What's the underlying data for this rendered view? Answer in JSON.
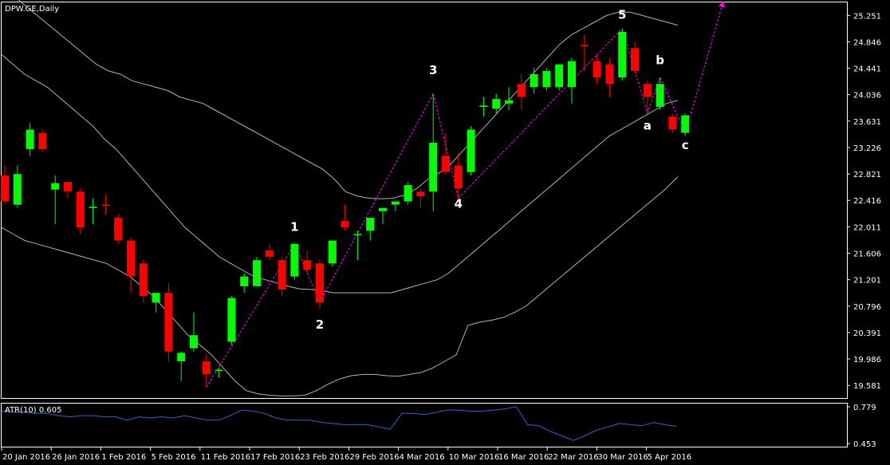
{
  "window": {
    "title": "DPW.GE,Daily",
    "indicator_label": "ATR(10) 0.605"
  },
  "colors": {
    "background": "#000000",
    "bull_candle": "#00ff00",
    "bear_candle": "#ff0000",
    "wick": "#c0c0c0",
    "band": "#b4b4b4",
    "wave_line": "#ff00ff",
    "atr_line": "#3a5fcd",
    "axis": "#ffffff",
    "label": "#ffffff"
  },
  "chart_data": [
    {
      "type": "candlestick",
      "symbol": "DPW.GE",
      "timeframe": "Daily",
      "grid": false,
      "ylim": [
        19.4,
        25.45
      ],
      "y_ticks": [
        "25.251",
        "24.846",
        "24.441",
        "24.036",
        "23.631",
        "23.226",
        "22.821",
        "22.416",
        "22.011",
        "21.606",
        "21.201",
        "20.796",
        "20.391",
        "19.986",
        "19.581"
      ],
      "x_ticks": [
        "20 Jan 2016",
        "26 Jan 2016",
        "1 Feb 2016",
        "5 Feb 2016",
        "11 Feb 2016",
        "17 Feb 2016",
        "23 Feb 2016",
        "29 Feb 2016",
        "4 Mar 2016",
        "10 Mar 2016",
        "16 Mar 2016",
        "22 Mar 2016",
        "30 Mar 2016",
        "5 Apr 2016"
      ],
      "candles": [
        {
          "date": "2016-01-18",
          "open": 22.8,
          "high": 22.95,
          "low": 22.35,
          "close": 22.4
        },
        {
          "date": "2016-01-19",
          "open": 22.35,
          "high": 22.95,
          "low": 22.3,
          "close": 22.82
        },
        {
          "date": "2016-01-20",
          "open": 23.2,
          "high": 23.6,
          "low": 23.1,
          "close": 23.5
        },
        {
          "date": "2016-01-21",
          "open": 23.45,
          "high": 23.5,
          "low": 23.15,
          "close": 23.2
        },
        {
          "date": "2016-01-22",
          "open": 22.58,
          "high": 22.8,
          "low": 22.05,
          "close": 22.68
        },
        {
          "date": "2016-01-25",
          "open": 22.7,
          "high": 22.7,
          "low": 22.45,
          "close": 22.55
        },
        {
          "date": "2016-01-26",
          "open": 22.55,
          "high": 22.6,
          "low": 21.9,
          "close": 22.0
        },
        {
          "date": "2016-01-27",
          "open": 22.3,
          "high": 22.45,
          "low": 22.05,
          "close": 22.32
        },
        {
          "date": "2016-01-28",
          "open": 22.35,
          "high": 22.5,
          "low": 22.2,
          "close": 22.33
        },
        {
          "date": "2016-01-29",
          "open": 22.15,
          "high": 22.2,
          "low": 21.75,
          "close": 21.8
        },
        {
          "date": "2016-02-01",
          "open": 21.8,
          "high": 21.85,
          "low": 21.0,
          "close": 21.25
        },
        {
          "date": "2016-02-02",
          "open": 21.45,
          "high": 21.5,
          "low": 20.85,
          "close": 20.95
        },
        {
          "date": "2016-02-03",
          "open": 20.85,
          "high": 21.0,
          "low": 20.7,
          "close": 21.0
        },
        {
          "date": "2016-02-04",
          "open": 21.0,
          "high": 21.15,
          "low": 19.95,
          "close": 20.1
        },
        {
          "date": "2016-02-05",
          "open": 19.95,
          "high": 20.1,
          "low": 19.65,
          "close": 20.08
        },
        {
          "date": "2016-02-08",
          "open": 20.15,
          "high": 20.7,
          "low": 20.1,
          "close": 20.35
        },
        {
          "date": "2016-02-09",
          "open": 19.95,
          "high": 20.05,
          "low": 19.55,
          "close": 19.75
        },
        {
          "date": "2016-02-10",
          "open": 19.8,
          "high": 19.85,
          "low": 19.7,
          "close": 19.82
        },
        {
          "date": "2016-02-11",
          "open": 20.25,
          "high": 20.95,
          "low": 20.2,
          "close": 20.92
        },
        {
          "date": "2016-02-12",
          "open": 21.1,
          "high": 21.3,
          "low": 21.0,
          "close": 21.25
        },
        {
          "date": "2016-02-15",
          "open": 21.1,
          "high": 21.55,
          "low": 21.1,
          "close": 21.5
        },
        {
          "date": "2016-02-16",
          "open": 21.65,
          "high": 21.75,
          "low": 21.5,
          "close": 21.55
        },
        {
          "date": "2016-02-17",
          "open": 21.5,
          "high": 21.55,
          "low": 20.95,
          "close": 21.05
        },
        {
          "date": "2016-02-18",
          "open": 21.25,
          "high": 21.75,
          "low": 21.2,
          "close": 21.75
        },
        {
          "date": "2016-02-19",
          "open": 21.5,
          "high": 21.65,
          "low": 21.3,
          "close": 21.35
        },
        {
          "date": "2016-02-22",
          "open": 21.45,
          "high": 21.5,
          "low": 20.75,
          "close": 20.85
        },
        {
          "date": "2016-02-23",
          "open": 21.45,
          "high": 21.8,
          "low": 21.4,
          "close": 21.8
        },
        {
          "date": "2016-02-24",
          "open": 22.1,
          "high": 22.35,
          "low": 21.95,
          "close": 22.0
        },
        {
          "date": "2016-02-25",
          "open": 21.9,
          "high": 21.95,
          "low": 21.5,
          "close": 21.9
        },
        {
          "date": "2016-02-26",
          "open": 21.95,
          "high": 22.15,
          "low": 21.8,
          "close": 22.15
        },
        {
          "date": "2016-02-29",
          "open": 22.25,
          "high": 22.3,
          "low": 22.05,
          "close": 22.3
        },
        {
          "date": "2016-03-01",
          "open": 22.35,
          "high": 22.4,
          "low": 22.25,
          "close": 22.4
        },
        {
          "date": "2016-03-02",
          "open": 22.4,
          "high": 22.7,
          "low": 22.35,
          "close": 22.65
        },
        {
          "date": "2016-03-03",
          "open": 22.55,
          "high": 22.6,
          "low": 22.3,
          "close": 22.48
        },
        {
          "date": "2016-03-04",
          "open": 22.55,
          "high": 24.05,
          "low": 22.25,
          "close": 23.3
        },
        {
          "date": "2016-03-07",
          "open": 23.1,
          "high": 23.45,
          "low": 22.8,
          "close": 22.85
        },
        {
          "date": "2016-03-08",
          "open": 22.95,
          "high": 23.15,
          "low": 22.4,
          "close": 22.6
        },
        {
          "date": "2016-03-09",
          "open": 22.85,
          "high": 23.55,
          "low": 22.8,
          "close": 23.5
        },
        {
          "date": "2016-03-10",
          "open": 23.85,
          "high": 24.0,
          "low": 23.7,
          "close": 23.87
        },
        {
          "date": "2016-03-11",
          "open": 23.82,
          "high": 24.05,
          "low": 23.75,
          "close": 23.97
        },
        {
          "date": "2016-03-14",
          "open": 23.9,
          "high": 24.15,
          "low": 23.8,
          "close": 23.95
        },
        {
          "date": "2016-03-15",
          "open": 24.2,
          "high": 24.35,
          "low": 23.8,
          "close": 24.0
        },
        {
          "date": "2016-03-16",
          "open": 24.15,
          "high": 24.45,
          "low": 24.05,
          "close": 24.35
        },
        {
          "date": "2016-03-17",
          "open": 24.15,
          "high": 24.45,
          "low": 24.1,
          "close": 24.4
        },
        {
          "date": "2016-03-18",
          "open": 24.15,
          "high": 24.5,
          "low": 24.1,
          "close": 24.5
        },
        {
          "date": "2016-03-21",
          "open": 24.15,
          "high": 24.6,
          "low": 23.9,
          "close": 24.55
        },
        {
          "date": "2016-03-22",
          "open": 24.8,
          "high": 24.95,
          "low": 24.4,
          "close": 24.78
        },
        {
          "date": "2016-03-23",
          "open": 24.55,
          "high": 24.65,
          "low": 24.2,
          "close": 24.3
        },
        {
          "date": "2016-03-24",
          "open": 24.5,
          "high": 24.6,
          "low": 24.0,
          "close": 24.2
        },
        {
          "date": "2016-03-29",
          "open": 24.3,
          "high": 25.05,
          "low": 24.25,
          "close": 25.0
        },
        {
          "date": "2016-03-30",
          "open": 24.75,
          "high": 24.85,
          "low": 24.35,
          "close": 24.4
        },
        {
          "date": "2016-03-31",
          "open": 24.2,
          "high": 24.25,
          "low": 23.75,
          "close": 24.0
        },
        {
          "date": "2016-04-01",
          "open": 23.85,
          "high": 24.3,
          "low": 23.8,
          "close": 24.2
        },
        {
          "date": "2016-04-04",
          "open": 23.7,
          "high": 23.75,
          "low": 23.45,
          "close": 23.5
        },
        {
          "date": "2016-04-05",
          "open": 23.45,
          "high": 23.75,
          "low": 23.4,
          "close": 23.72
        }
      ],
      "bollinger_bands": {
        "upper": [
          25.65,
          25.55,
          25.4,
          25.25,
          25.1,
          24.95,
          24.8,
          24.65,
          24.5,
          24.4,
          24.35,
          24.25,
          24.2,
          24.15,
          24.1,
          24.0,
          23.95,
          23.9,
          23.8,
          23.7,
          23.6,
          23.5,
          23.4,
          23.3,
          23.2,
          23.1,
          23.0,
          22.9,
          22.75,
          22.55,
          22.48,
          22.45,
          22.44,
          22.45,
          22.5,
          22.6,
          22.75,
          22.85,
          23.0,
          23.2,
          23.4,
          23.6,
          23.8,
          24.0,
          24.2,
          24.4,
          24.6,
          24.8,
          24.95,
          25.05,
          25.15,
          25.25,
          25.3,
          25.3,
          25.25,
          25.2,
          25.15,
          25.1
        ],
        "middle": [
          24.65,
          24.5,
          24.35,
          24.25,
          24.15,
          24.0,
          23.85,
          23.7,
          23.55,
          23.35,
          23.2,
          23.0,
          22.8,
          22.6,
          22.4,
          22.2,
          22.0,
          21.85,
          21.7,
          21.55,
          21.45,
          21.35,
          21.25,
          21.2,
          21.15,
          21.1,
          21.06,
          21.05,
          21.03,
          21.0,
          21.0,
          21.0,
          21.0,
          21.0,
          21.0,
          21.05,
          21.1,
          21.15,
          21.2,
          21.3,
          21.45,
          21.6,
          21.75,
          21.9,
          22.05,
          22.2,
          22.35,
          22.5,
          22.65,
          22.8,
          22.95,
          23.1,
          23.25,
          23.4,
          23.5,
          23.6,
          23.7,
          23.8,
          23.9,
          23.95
        ],
        "lower": [
          22.0,
          21.9,
          21.8,
          21.75,
          21.7,
          21.65,
          21.6,
          21.55,
          21.5,
          21.45,
          21.35,
          21.25,
          21.1,
          20.95,
          20.75,
          20.55,
          20.35,
          20.2,
          20.05,
          19.85,
          19.65,
          19.5,
          19.45,
          19.43,
          19.42,
          19.42,
          19.43,
          19.5,
          19.6,
          19.68,
          19.73,
          19.75,
          19.75,
          19.73,
          19.72,
          19.75,
          19.78,
          19.85,
          19.95,
          20.05,
          20.5,
          20.55,
          20.58,
          20.62,
          20.7,
          20.8,
          20.95,
          21.1,
          21.25,
          21.4,
          21.55,
          21.7,
          21.85,
          22.0,
          22.15,
          22.3,
          22.45,
          22.6,
          22.78
        ]
      },
      "annotations": [
        {
          "text": "1",
          "date": "2016-02-18",
          "price": 21.95
        },
        {
          "text": "2",
          "date": "2016-02-22",
          "price": 20.45
        },
        {
          "text": "3",
          "date": "2016-03-04",
          "price": 24.35
        },
        {
          "text": "4",
          "date": "2016-03-08",
          "price": 22.3
        },
        {
          "text": "5",
          "date": "2016-03-29",
          "price": 25.2
        },
        {
          "text": "a",
          "date": "2016-03-31",
          "price": 23.5
        },
        {
          "text": "b",
          "date": "2016-04-01",
          "price": 24.5
        },
        {
          "text": "c",
          "date": "2016-04-05",
          "price": 23.2
        }
      ],
      "wave_path": [
        {
          "date": "2016-02-09",
          "price": 19.55
        },
        {
          "date": "2016-02-18",
          "price": 21.75
        },
        {
          "date": "2016-02-22",
          "price": 20.85
        },
        {
          "date": "2016-03-04",
          "price": 24.05
        },
        {
          "date": "2016-03-08",
          "price": 22.45
        },
        {
          "date": "2016-03-29",
          "price": 25.05
        },
        {
          "date": "2016-03-31",
          "price": 23.75
        },
        {
          "date": "2016-04-01",
          "price": 24.3
        },
        {
          "date": "2016-04-05",
          "price": 23.45
        },
        {
          "date": "2016-04-09",
          "price": 25.45,
          "arrow": true
        }
      ]
    },
    {
      "type": "line",
      "name": "ATR(10)",
      "value": 0.605,
      "ylim": [
        0.453,
        0.779
      ],
      "y_ticks": [
        "0.779",
        "0.453"
      ],
      "values": [
        0.74,
        0.73,
        0.73,
        0.72,
        0.72,
        0.7,
        0.69,
        0.7,
        0.7,
        0.69,
        0.69,
        0.66,
        0.69,
        0.68,
        0.69,
        0.68,
        0.7,
        0.68,
        0.66,
        0.66,
        0.7,
        0.75,
        0.74,
        0.72,
        0.68,
        0.66,
        0.66,
        0.66,
        0.64,
        0.63,
        0.62,
        0.62,
        0.62,
        0.6,
        0.58,
        0.72,
        0.72,
        0.71,
        0.73,
        0.75,
        0.75,
        0.74,
        0.74,
        0.75,
        0.76,
        0.78,
        0.62,
        0.61,
        0.56,
        0.52,
        0.48,
        0.52,
        0.57,
        0.6,
        0.63,
        0.62,
        0.61,
        0.64,
        0.62,
        0.605
      ]
    }
  ]
}
